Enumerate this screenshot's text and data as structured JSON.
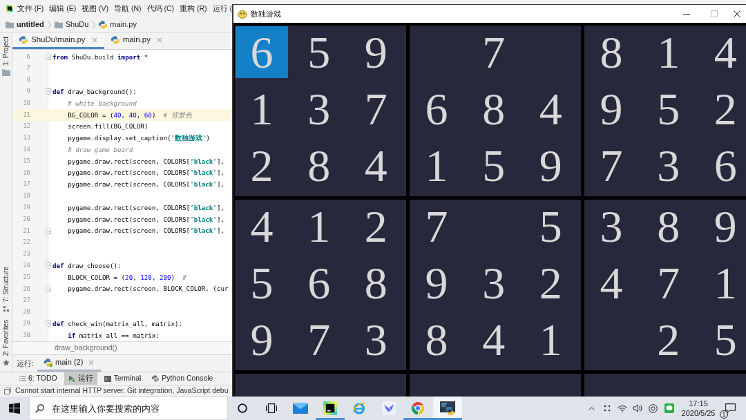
{
  "ide": {
    "menu": [
      "文件 (F)",
      "编辑 (E)",
      "视图 (V)",
      "导航 (N)",
      "代码 (C)",
      "重构 (R)",
      "运行 ("
    ],
    "breadcrumbs": [
      {
        "kind": "project",
        "label": "untitled"
      },
      {
        "kind": "folder",
        "label": "ShuDu"
      },
      {
        "kind": "python",
        "label": "main.py"
      }
    ],
    "side_tools": [
      {
        "kind": "project",
        "label": "1: Project"
      },
      {
        "kind": "structure",
        "label": "7: Structure"
      },
      {
        "kind": "favorites",
        "label": "2: Favorites"
      }
    ],
    "editor_tabs": [
      {
        "label": "ShuDu\\main.py",
        "selected": true
      },
      {
        "label": "main.py",
        "selected": false
      }
    ],
    "code": [
      {
        "number": "6",
        "kind": "fold_end",
        "current": false,
        "tokens": [
          {
            "kind": "keyword",
            "text": "from"
          },
          {
            "kind": "plain",
            "text": " ShuDu.build "
          },
          {
            "kind": "keyword",
            "text": "import"
          },
          {
            "kind": "plain",
            "text": " *"
          }
        ]
      },
      {
        "number": "7",
        "kind": "plain",
        "current": false
      },
      {
        "number": "8",
        "kind": "plain",
        "current": false
      },
      {
        "number": "9",
        "kind": "fold_start",
        "current": false,
        "tokens": [
          {
            "kind": "keyword",
            "text": "def"
          },
          {
            "kind": "plain",
            "text": " draw_background():"
          }
        ],
        "children": [
          {
            "number": "10",
            "kind": "plain",
            "current": false,
            "tokens": [
              {
                "kind": "comment",
                "text": "# white background"
              }
            ]
          },
          {
            "number": "11",
            "kind": "plain",
            "current": true,
            "tokens": [
              {
                "kind": "plain",
                "text": "BG_COLOR = ("
              },
              {
                "kind": "number",
                "text": "40"
              },
              {
                "kind": "plain",
                "text": ", "
              },
              {
                "kind": "number",
                "text": "40"
              },
              {
                "kind": "plain",
                "text": ", "
              },
              {
                "kind": "number",
                "text": "60"
              },
              {
                "kind": "plain",
                "text": ")  "
              },
              {
                "kind": "comment",
                "text": "# 背景色"
              }
            ]
          },
          {
            "number": "12",
            "kind": "plain",
            "current": false,
            "tokens": [
              {
                "kind": "plain",
                "text": "screen.fill(BG_COLOR)"
              }
            ]
          },
          {
            "number": "13",
            "kind": "plain",
            "current": false,
            "tokens": [
              {
                "kind": "plain",
                "text": "pygame.display.set_caption("
              },
              {
                "kind": "string",
                "text": "'数独游戏'"
              },
              {
                "kind": "plain",
                "text": ")"
              }
            ]
          },
          {
            "number": "14",
            "kind": "plain",
            "current": false,
            "tokens": [
              {
                "kind": "comment",
                "text": "# draw game board"
              }
            ]
          },
          {
            "number": "15",
            "kind": "plain",
            "current": false,
            "tokens": [
              {
                "kind": "plain",
                "text": "pygame.draw.rect(screen, COLORS["
              },
              {
                "kind": "string",
                "text": "'black'"
              },
              {
                "kind": "plain",
                "text": "],"
              }
            ]
          },
          {
            "number": "16",
            "kind": "plain",
            "current": false,
            "tokens": [
              {
                "kind": "plain",
                "text": "pygame.draw.rect(screen, COLORS["
              },
              {
                "kind": "string",
                "text": "'black'"
              },
              {
                "kind": "plain",
                "text": "],"
              }
            ]
          },
          {
            "number": "17",
            "kind": "plain",
            "current": false,
            "tokens": [
              {
                "kind": "plain",
                "text": "pygame.draw.rect(screen, COLORS["
              },
              {
                "kind": "string",
                "text": "'black'"
              },
              {
                "kind": "plain",
                "text": "],"
              }
            ]
          },
          {
            "number": "18",
            "kind": "plain",
            "current": false
          },
          {
            "number": "19",
            "kind": "plain",
            "current": false,
            "tokens": [
              {
                "kind": "plain",
                "text": "pygame.draw.rect(screen, COLORS["
              },
              {
                "kind": "string",
                "text": "'black'"
              },
              {
                "kind": "plain",
                "text": "],"
              }
            ]
          },
          {
            "number": "20",
            "kind": "plain",
            "current": false,
            "tokens": [
              {
                "kind": "plain",
                "text": "pygame.draw.rect(screen, COLORS["
              },
              {
                "kind": "string",
                "text": "'black'"
              },
              {
                "kind": "plain",
                "text": "],"
              }
            ]
          },
          {
            "number": "21",
            "kind": "fold_end",
            "current": false,
            "tokens": [
              {
                "kind": "plain",
                "text": "pygame.draw.rect(screen, COLORS["
              },
              {
                "kind": "string",
                "text": "'black'"
              },
              {
                "kind": "plain",
                "text": "],"
              }
            ]
          }
        ]
      },
      {
        "number": "22",
        "kind": "plain",
        "current": false
      },
      {
        "number": "23",
        "kind": "plain",
        "current": false
      },
      {
        "number": "24",
        "kind": "fold_start",
        "current": false,
        "tokens": [
          {
            "kind": "keyword",
            "text": "def"
          },
          {
            "kind": "plain",
            "text": " draw_choose():"
          }
        ],
        "children": [
          {
            "number": "25",
            "kind": "plain",
            "current": false,
            "tokens": [
              {
                "kind": "plain",
                "text": "BLOCK_COLOR = ("
              },
              {
                "kind": "number",
                "text": "20"
              },
              {
                "kind": "plain",
                "text": ", "
              },
              {
                "kind": "number",
                "text": "128"
              },
              {
                "kind": "plain",
                "text": ", "
              },
              {
                "kind": "number",
                "text": "200"
              },
              {
                "kind": "plain",
                "text": ")  "
              },
              {
                "kind": "comment",
                "text": "#"
              }
            ]
          },
          {
            "number": "26",
            "kind": "fold_end",
            "current": false,
            "tokens": [
              {
                "kind": "plain",
                "text": "pygame.draw.rect(screen, BLOCK_COLOR, (cur"
              }
            ]
          }
        ]
      },
      {
        "number": "27",
        "kind": "plain",
        "current": false
      },
      {
        "number": "28",
        "kind": "plain",
        "current": false
      },
      {
        "number": "29",
        "kind": "fold_start",
        "current": false,
        "tokens": [
          {
            "kind": "keyword",
            "text": "def"
          },
          {
            "kind": "plain",
            "text": " check_win(matrix_all, matrix):"
          }
        ],
        "children": [
          {
            "number": "30",
            "kind": "plain",
            "current": false,
            "tokens": [
              {
                "kind": "keyword",
                "text": "if"
              },
              {
                "kind": "plain",
                "text": " matrix all == matrix:"
              }
            ]
          }
        ]
      }
    ],
    "scope_crumb": "draw_background()",
    "run_label": "运行:",
    "run_tabs": [
      {
        "label": "main (2)",
        "selected": true
      }
    ],
    "tool_tabs": [
      {
        "kind": "todo",
        "label": "6: TODO",
        "selected": false
      },
      {
        "kind": "run",
        "label": "运行",
        "selected": true
      },
      {
        "kind": "terminal",
        "label": "Terminal",
        "selected": false
      },
      {
        "kind": "console",
        "label": "Python Console",
        "selected": false
      }
    ],
    "status_message": "Cannot start internal HTTP server. Git integration, JavaScript debu"
  },
  "game_window": {
    "title": "数独游戏",
    "rows": [
      {
        "cells": [
          {
            "value": "6",
            "selected": true
          },
          {
            "value": "5",
            "selected": false
          },
          {
            "value": "9",
            "selected": false
          },
          {
            "selected": false
          },
          {
            "value": "7",
            "selected": false
          },
          {
            "selected": false
          },
          {
            "value": "8",
            "selected": false
          },
          {
            "value": "1",
            "selected": false
          },
          {
            "value": "4",
            "selected": false
          }
        ]
      },
      {
        "cells": [
          {
            "value": "1",
            "selected": false
          },
          {
            "value": "3",
            "selected": false
          },
          {
            "value": "7",
            "selected": false
          },
          {
            "value": "6",
            "selected": false
          },
          {
            "value": "8",
            "selected": false
          },
          {
            "value": "4",
            "selected": false
          },
          {
            "value": "9",
            "selected": false
          },
          {
            "value": "5",
            "selected": false
          },
          {
            "value": "2",
            "selected": false
          }
        ]
      },
      {
        "cells": [
          {
            "value": "2",
            "selected": false
          },
          {
            "value": "8",
            "selected": false
          },
          {
            "value": "4",
            "selected": false
          },
          {
            "value": "1",
            "selected": false
          },
          {
            "value": "5",
            "selected": false
          },
          {
            "value": "9",
            "selected": false
          },
          {
            "value": "7",
            "selected": false
          },
          {
            "value": "3",
            "selected": false
          },
          {
            "value": "6",
            "selected": false
          }
        ]
      },
      {
        "cells": [
          {
            "value": "4",
            "selected": false
          },
          {
            "value": "1",
            "selected": false
          },
          {
            "value": "2",
            "selected": false
          },
          {
            "value": "7",
            "selected": false
          },
          {
            "selected": false
          },
          {
            "value": "5",
            "selected": false
          },
          {
            "value": "3",
            "selected": false
          },
          {
            "value": "8",
            "selected": false
          },
          {
            "value": "9",
            "selected": false
          }
        ]
      },
      {
        "cells": [
          {
            "value": "5",
            "selected": false
          },
          {
            "value": "6",
            "selected": false
          },
          {
            "value": "8",
            "selected": false
          },
          {
            "value": "9",
            "selected": false
          },
          {
            "value": "3",
            "selected": false
          },
          {
            "value": "2",
            "selected": false
          },
          {
            "value": "4",
            "selected": false
          },
          {
            "value": "7",
            "selected": false
          },
          {
            "value": "1",
            "selected": false
          }
        ]
      },
      {
        "cells": [
          {
            "value": "9",
            "selected": false
          },
          {
            "value": "7",
            "selected": false
          },
          {
            "value": "3",
            "selected": false
          },
          {
            "value": "8",
            "selected": false
          },
          {
            "value": "4",
            "selected": false
          },
          {
            "value": "1",
            "selected": false
          },
          {
            "selected": false
          },
          {
            "value": "2",
            "selected": false
          },
          {
            "value": "5",
            "selected": false
          }
        ]
      }
    ]
  },
  "taskbar": {
    "search": {
      "placeholder": "在这里输入你要搜索的内容"
    },
    "apps": [
      {
        "kind": "mail",
        "running": false,
        "selected": false
      },
      {
        "kind": "ide",
        "running": true,
        "selected": false
      },
      {
        "kind": "browser_e",
        "running": false,
        "selected": false
      },
      {
        "kind": "messenger",
        "running": false,
        "selected": false
      },
      {
        "kind": "browser",
        "running": true,
        "selected": false
      },
      {
        "kind": "python_window",
        "running": true,
        "selected": true
      }
    ],
    "time": "17:15",
    "date": "2020/5/25",
    "notification_count": "1"
  }
}
